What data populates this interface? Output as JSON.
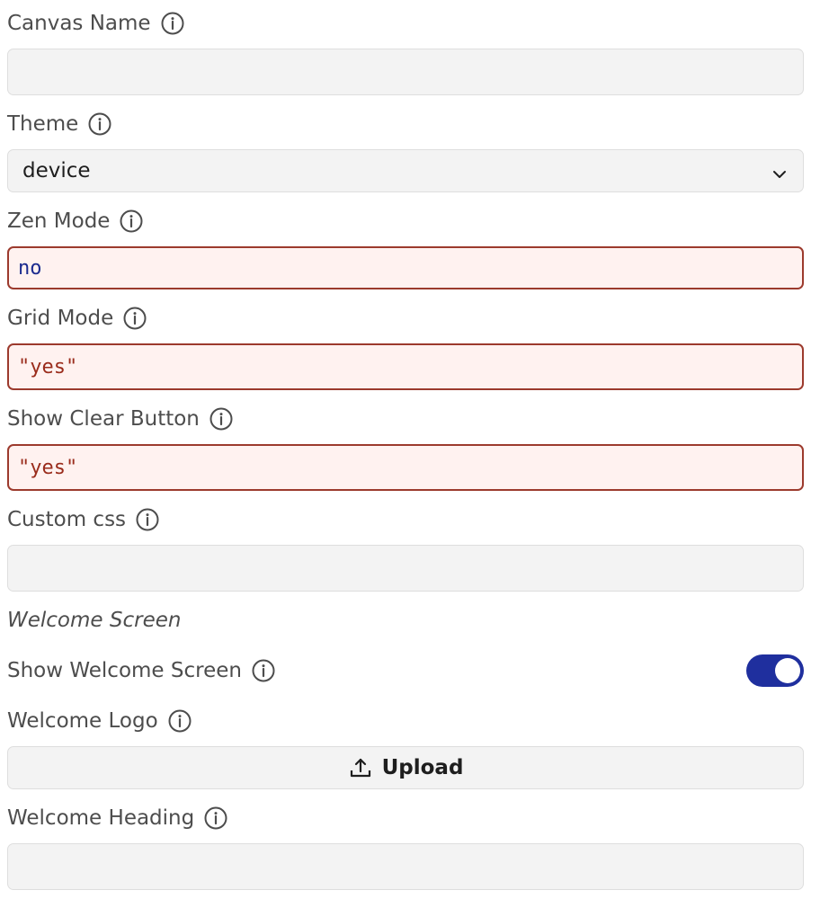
{
  "fields": {
    "canvas_name": {
      "label": "Canvas Name",
      "value": ""
    },
    "theme": {
      "label": "Theme",
      "value": "device"
    },
    "zen_mode": {
      "label": "Zen Mode",
      "value": "no"
    },
    "grid_mode": {
      "label": "Grid Mode",
      "value": "\"yes\""
    },
    "show_clear_button": {
      "label": "Show Clear Button",
      "value": "\"yes\""
    },
    "custom_css": {
      "label": "Custom css",
      "value": ""
    }
  },
  "welcome": {
    "section_title": "Welcome Screen",
    "show_welcome_screen": {
      "label": "Show Welcome Screen",
      "enabled": true
    },
    "welcome_logo": {
      "label": "Welcome Logo",
      "upload_label": "Upload"
    },
    "welcome_heading": {
      "label": "Welcome Heading",
      "value": ""
    }
  },
  "icons": {
    "info": "info-circle-icon",
    "select": "chevron-down-icon",
    "upload": "upload-icon"
  },
  "colors": {
    "accent": "#1f2f9e",
    "error_border": "#9c3a2d",
    "error_background": "#fff2f0",
    "keyword_text": "#1c2b8f",
    "string_text": "#9a2c1c",
    "field_background": "#f3f3f3"
  }
}
